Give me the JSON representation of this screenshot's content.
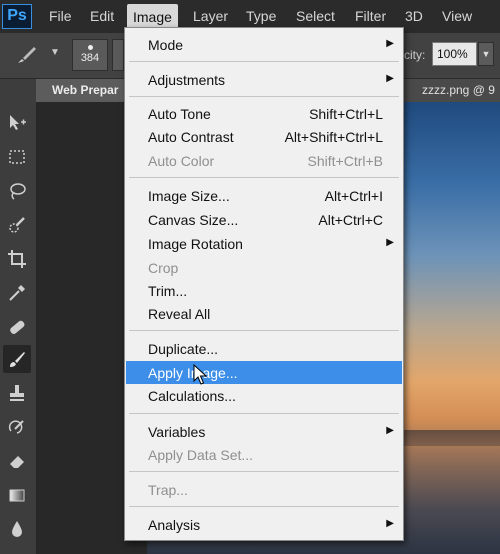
{
  "app": {
    "logo": "Ps"
  },
  "menubar": {
    "items": [
      "File",
      "Edit",
      "Image",
      "Layer",
      "Type",
      "Select",
      "Filter",
      "3D",
      "View"
    ],
    "active": "Image"
  },
  "options": {
    "brush_size": "384",
    "opacity_label": "city:",
    "opacity_value": "100%"
  },
  "tabs": [
    "Web Prepar",
    "zzzz.png @ 9"
  ],
  "image_menu": {
    "items": [
      {
        "label": "Mode",
        "submenu": true
      },
      {
        "label": "Adjustments",
        "submenu": true
      },
      {
        "label": "Auto Tone",
        "shortcut": "Shift+Ctrl+L"
      },
      {
        "label": "Auto Contrast",
        "shortcut": "Alt+Shift+Ctrl+L"
      },
      {
        "label": "Auto Color",
        "shortcut": "Shift+Ctrl+B",
        "disabled": true
      },
      {
        "label": "Image Size...",
        "shortcut": "Alt+Ctrl+I"
      },
      {
        "label": "Canvas Size...",
        "shortcut": "Alt+Ctrl+C"
      },
      {
        "label": "Image Rotation",
        "submenu": true
      },
      {
        "label": "Crop",
        "disabled": true
      },
      {
        "label": "Trim..."
      },
      {
        "label": "Reveal All"
      },
      {
        "label": "Duplicate..."
      },
      {
        "label": "Apply Image...",
        "highlighted": true
      },
      {
        "label": "Calculations..."
      },
      {
        "label": "Variables",
        "submenu": true
      },
      {
        "label": "Apply Data Set...",
        "disabled": true
      },
      {
        "label": "Trap...",
        "disabled": true
      },
      {
        "label": "Analysis",
        "submenu": true
      }
    ]
  },
  "icons": {
    "submenu_arrow": "▶",
    "tools": [
      "move-icon",
      "marquee-icon",
      "lasso-icon",
      "quick-selection-icon",
      "crop-icon",
      "eyedropper-icon",
      "healing-brush-icon",
      "brush-icon",
      "clone-stamp-icon",
      "history-brush-icon",
      "eraser-icon",
      "gradient-icon",
      "blur-icon"
    ]
  },
  "colors": {
    "highlight": "#3c8ee8",
    "disabled": "#8f8f8f"
  }
}
